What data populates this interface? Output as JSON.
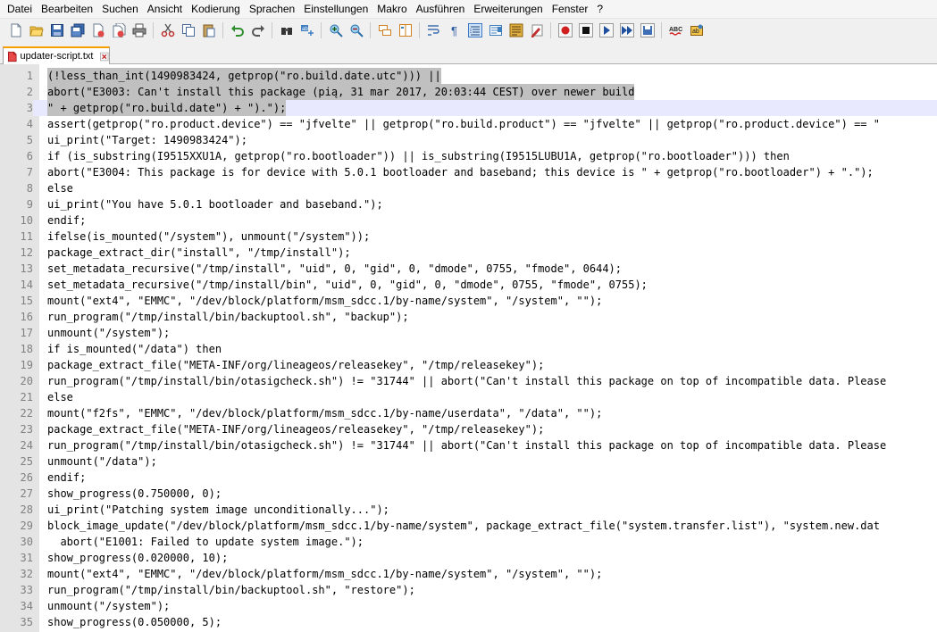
{
  "menubar": {
    "items": [
      "Datei",
      "Bearbeiten",
      "Suchen",
      "Ansicht",
      "Kodierung",
      "Sprachen",
      "Einstellungen",
      "Makro",
      "Ausführen",
      "Erweiterungen",
      "Fenster",
      "?"
    ]
  },
  "toolbar": {
    "icons": [
      "new-file-icon",
      "open-file-icon",
      "save-icon",
      "save-all-icon",
      "close-icon",
      "close-all-icon",
      "print-icon",
      "cut-icon",
      "copy-icon",
      "paste-icon",
      "undo-icon",
      "redo-icon",
      "find-icon",
      "replace-icon",
      "zoom-in-icon",
      "zoom-out-icon",
      "sync-vertical-icon",
      "sync-horizontal-icon",
      "word-wrap-icon",
      "show-all-chars-icon",
      "indent-guide-icon",
      "doc-map-icon",
      "function-list-icon",
      "folder-workspace-icon",
      "record-macro-icon",
      "stop-macro-icon",
      "play-macro-icon",
      "run-macro-multiple-icon",
      "save-macro-icon",
      "spell-check-icon",
      "spell-check-options-icon"
    ]
  },
  "tab": {
    "label": "updater-script.txt"
  },
  "colors": {
    "tab_accent": "#f7a000",
    "gutter": "#e4e4e4",
    "selection": "#c0c0c0",
    "current_line": "#e8e8ff"
  },
  "editor": {
    "lines": [
      "(!less_than_int(1490983424, getprop(\"ro.build.date.utc\"))) ||",
      "abort(\"E3003: Can't install this package (pią, 31 mar 2017, 20:03:44 CEST) over newer build",
      "\" + getprop(\"ro.build.date\") + \").\");",
      "assert(getprop(\"ro.product.device\") == \"jfvelte\" || getprop(\"ro.build.product\") == \"jfvelte\" || getprop(\"ro.product.device\") == \"",
      "ui_print(\"Target: 1490983424\");",
      "if (is_substring(I9515XXU1A, getprop(\"ro.bootloader\")) || is_substring(I9515LUBU1A, getprop(\"ro.bootloader\"))) then",
      "abort(\"E3004: This package is for device with 5.0.1 bootloader and baseband; this device is \" + getprop(\"ro.bootloader\") + \".\");",
      "else",
      "ui_print(\"You have 5.0.1 bootloader and baseband.\");",
      "endif;",
      "ifelse(is_mounted(\"/system\"), unmount(\"/system\"));",
      "package_extract_dir(\"install\", \"/tmp/install\");",
      "set_metadata_recursive(\"/tmp/install\", \"uid\", 0, \"gid\", 0, \"dmode\", 0755, \"fmode\", 0644);",
      "set_metadata_recursive(\"/tmp/install/bin\", \"uid\", 0, \"gid\", 0, \"dmode\", 0755, \"fmode\", 0755);",
      "mount(\"ext4\", \"EMMC\", \"/dev/block/platform/msm_sdcc.1/by-name/system\", \"/system\", \"\");",
      "run_program(\"/tmp/install/bin/backuptool.sh\", \"backup\");",
      "unmount(\"/system\");",
      "if is_mounted(\"/data\") then",
      "package_extract_file(\"META-INF/org/lineageos/releasekey\", \"/tmp/releasekey\");",
      "run_program(\"/tmp/install/bin/otasigcheck.sh\") != \"31744\" || abort(\"Can't install this package on top of incompatible data. Please",
      "else",
      "mount(\"f2fs\", \"EMMC\", \"/dev/block/platform/msm_sdcc.1/by-name/userdata\", \"/data\", \"\");",
      "package_extract_file(\"META-INF/org/lineageos/releasekey\", \"/tmp/releasekey\");",
      "run_program(\"/tmp/install/bin/otasigcheck.sh\") != \"31744\" || abort(\"Can't install this package on top of incompatible data. Please",
      "unmount(\"/data\");",
      "endif;",
      "show_progress(0.750000, 0);",
      "ui_print(\"Patching system image unconditionally...\");",
      "block_image_update(\"/dev/block/platform/msm_sdcc.1/by-name/system\", package_extract_file(\"system.transfer.list\"), \"system.new.dat",
      "  abort(\"E1001: Failed to update system image.\");",
      "show_progress(0.020000, 10);",
      "mount(\"ext4\", \"EMMC\", \"/dev/block/platform/msm_sdcc.1/by-name/system\", \"/system\", \"\");",
      "run_program(\"/tmp/install/bin/backuptool.sh\", \"restore\");",
      "unmount(\"/system\");",
      "show_progress(0.050000, 5);"
    ]
  }
}
